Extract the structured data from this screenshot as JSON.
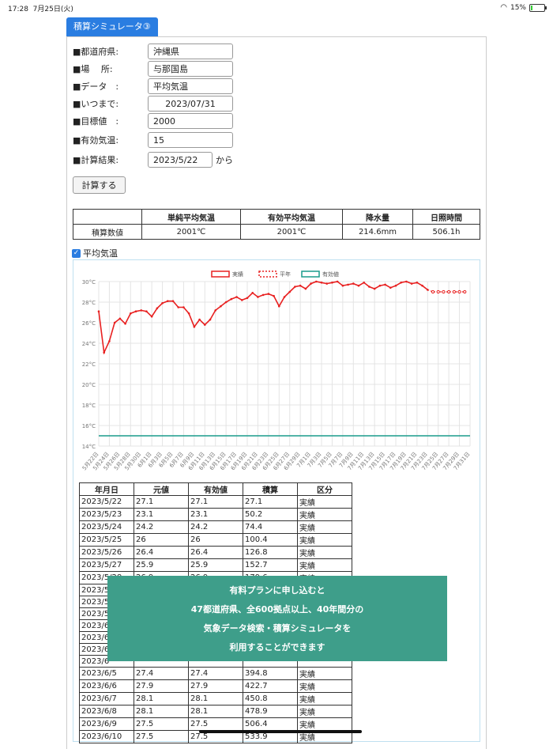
{
  "status": {
    "time": "17:28",
    "date": "7月25日(火)",
    "battery": "15%",
    "battery_level": 0.15
  },
  "title": "積算シミュレータ③",
  "form": {
    "prefecture_label": "■都道府県:",
    "prefecture": "沖縄県",
    "place_label": "■場　 所:",
    "place": "与那国島",
    "data_label": "■データ　:",
    "data": "平均気温",
    "until_label": "■いつまで:",
    "until": "2023/07/31",
    "target_label": "■目標値　:",
    "target": "2000",
    "effective_label": "■有効気温:",
    "effective": "15",
    "result_label": "■計算結果:",
    "result": "2023/5/22",
    "result_suffix": "から"
  },
  "calc_button": "計算する",
  "summary": {
    "headers": [
      "",
      "単純平均気温",
      "有効平均気温",
      "降水量",
      "日照時間"
    ],
    "row": [
      "積算数値",
      "2001℃",
      "2001℃",
      "214.6mm",
      "506.1h"
    ]
  },
  "checkbox_label": "平均気温",
  "chart_data": {
    "type": "line",
    "legend": [
      "実績",
      "平年",
      "有効値"
    ],
    "legend_position": "top",
    "colors": {
      "actual": "#e82020",
      "normal": "#e82020",
      "effective": "#1a9c8c"
    },
    "ylim": [
      14,
      30
    ],
    "yticks": [
      "14°C",
      "16°C",
      "18°C",
      "20°C",
      "22°C",
      "24°C",
      "26°C",
      "28°C",
      "30°C"
    ],
    "xticks": [
      "5月22日",
      "5月24日",
      "5月26日",
      "5月28日",
      "5月30日",
      "6月1日",
      "6月3日",
      "6月5日",
      "6月7日",
      "6月9日",
      "6月11日",
      "6月13日",
      "6月15日",
      "6月17日",
      "6月19日",
      "6月21日",
      "6月23日",
      "6月25日",
      "6月27日",
      "6月29日",
      "7月1日",
      "7月3日",
      "7月5日",
      "7月7日",
      "7月9日",
      "7月11日",
      "7月13日",
      "7月15日",
      "7月17日",
      "7月19日",
      "7月21日",
      "7月23日",
      "7月25日",
      "7月27日",
      "7月29日",
      "7月31日"
    ],
    "grid": true,
    "actual": [
      27.1,
      23.1,
      24.2,
      26,
      26.4,
      25.9,
      26.9,
      27.1,
      27.2,
      27.1,
      26.6,
      27.4,
      27.9,
      28.1,
      28.1,
      27.5,
      27.5,
      26.9,
      25.6,
      26.3,
      25.8,
      26.3,
      27.2,
      27.6,
      28.0,
      28.3,
      28.5,
      28.2,
      28.4,
      28.9,
      28.5,
      28.7,
      28.8,
      28.6,
      27.6,
      28.5,
      29.0,
      29.5,
      29.6,
      29.3,
      29.8,
      30.0,
      29.9,
      29.8,
      29.9,
      30.0,
      29.6,
      29.7,
      29.8,
      29.6,
      29.9,
      29.5,
      29.3,
      29.6,
      29.7,
      29.4,
      29.6,
      29.9,
      30.0,
      29.8,
      29.9,
      29.6,
      29.2
    ],
    "normal": [
      29.0,
      29.0,
      29.0,
      29.0,
      29.0,
      29.0,
      29.0
    ],
    "effective": 15
  },
  "table": {
    "headers": [
      "年月日",
      "元値",
      "有効値",
      "積算",
      "区分"
    ],
    "rows": [
      [
        "2023/5/22",
        "27.1",
        "27.1",
        "27.1",
        "実績"
      ],
      [
        "2023/5/23",
        "23.1",
        "23.1",
        "50.2",
        "実績"
      ],
      [
        "2023/5/24",
        "24.2",
        "24.2",
        "74.4",
        "実績"
      ],
      [
        "2023/5/25",
        "26",
        "26",
        "100.4",
        "実績"
      ],
      [
        "2023/5/26",
        "26.4",
        "26.4",
        "126.8",
        "実績"
      ],
      [
        "2023/5/27",
        "25.9",
        "25.9",
        "152.7",
        "実績"
      ],
      [
        "2023/5/28",
        "26.9",
        "26.9",
        "179.6",
        "実績"
      ],
      [
        "2023/5",
        "",
        "",
        "",
        ""
      ],
      [
        "2023/5",
        "",
        "",
        "",
        ""
      ],
      [
        "2023/5",
        "",
        "",
        "",
        ""
      ],
      [
        "2023/6",
        "",
        "",
        "",
        ""
      ],
      [
        "2023/6",
        "",
        "",
        "",
        ""
      ],
      [
        "2023/6",
        "",
        "",
        "",
        ""
      ],
      [
        "2023/6",
        "",
        "",
        "",
        ""
      ],
      [
        "2023/6/5",
        "27.4",
        "27.4",
        "394.8",
        "実績"
      ],
      [
        "2023/6/6",
        "27.9",
        "27.9",
        "422.7",
        "実績"
      ],
      [
        "2023/6/7",
        "28.1",
        "28.1",
        "450.8",
        "実績"
      ],
      [
        "2023/6/8",
        "28.1",
        "28.1",
        "478.9",
        "実績"
      ],
      [
        "2023/6/9",
        "27.5",
        "27.5",
        "506.4",
        "実績"
      ],
      [
        "2023/6/10",
        "27.5",
        "27.5",
        "533.9",
        "実績"
      ]
    ]
  },
  "overlay": [
    "有料プランに申し込むと",
    "47都道府県、全600拠点以上、40年間分の",
    "気象データ検索・積算シミュレータを",
    "利用することができます"
  ]
}
